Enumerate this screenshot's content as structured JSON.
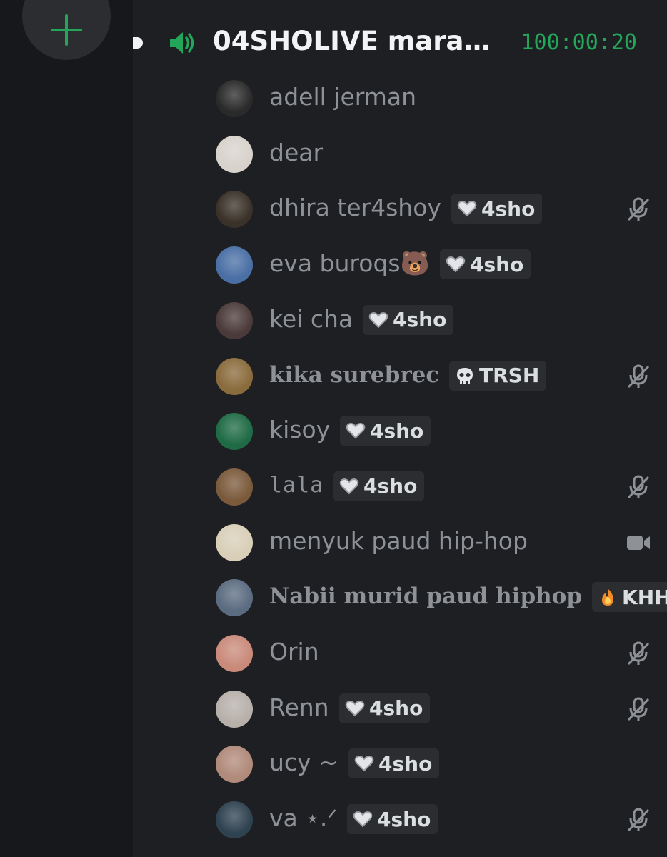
{
  "channel": {
    "name": "04SHOLIVE marat...",
    "timer": "100:00:20"
  },
  "members": [
    {
      "name": "adell jerman",
      "tag": null,
      "tag_icon": null,
      "status": null,
      "style": "normal",
      "avatar": "#2a2a2a"
    },
    {
      "name": "dear",
      "tag": null,
      "tag_icon": null,
      "status": null,
      "style": "normal",
      "avatar": "#d8d2cc"
    },
    {
      "name": "dhira ter4shoy",
      "tag": "4sho",
      "tag_icon": "heart-icon",
      "status": "muted",
      "style": "normal",
      "avatar": "#3a3128"
    },
    {
      "name": "eva buroqs🐻",
      "tag": "4sho",
      "tag_icon": "heart-icon",
      "status": null,
      "style": "normal",
      "avatar": "#4a6fa5"
    },
    {
      "name": "kei cha",
      "tag": "4sho",
      "tag_icon": "heart-icon",
      "status": null,
      "style": "normal",
      "avatar": "#4b3a3a"
    },
    {
      "name": "kika surebrec",
      "tag": "TRSH",
      "tag_icon": "skull-icon",
      "status": "muted",
      "style": "serif",
      "avatar": "#8a6b3c"
    },
    {
      "name": "kisoy",
      "tag": "4sho",
      "tag_icon": "heart-icon",
      "status": null,
      "style": "normal",
      "avatar": "#1f6b45"
    },
    {
      "name": "lala",
      "tag": "4sho",
      "tag_icon": "heart-icon",
      "status": "muted",
      "style": "pixel",
      "avatar": "#7a5a3b"
    },
    {
      "name": "menyuk paud hip-hop",
      "tag": null,
      "tag_icon": null,
      "status": "video",
      "style": "normal",
      "avatar": "#d9cfb8"
    },
    {
      "name": "Nabii murid paud hiphop",
      "tag": "KHH",
      "tag_icon": "fire-icon",
      "status": null,
      "style": "serif",
      "avatar": "#5b6b80"
    },
    {
      "name": "Orin",
      "tag": null,
      "tag_icon": null,
      "status": "muted",
      "style": "normal",
      "avatar": "#c98a7a"
    },
    {
      "name": "Renn",
      "tag": "4sho",
      "tag_icon": "heart-icon",
      "status": "muted",
      "style": "normal",
      "avatar": "#b7b0aa"
    },
    {
      "name": "ucy ~",
      "tag": "4sho",
      "tag_icon": "heart-icon",
      "status": null,
      "style": "normal",
      "avatar": "#b08a7a"
    },
    {
      "name": "va ⋆.ᐟ",
      "tag": "4sho",
      "tag_icon": "heart-icon",
      "status": "muted",
      "style": "normal",
      "avatar": "#2f4250"
    }
  ],
  "colors": {
    "background": "#1e1f22",
    "rail": "#17181b",
    "accent_green": "#23a55a",
    "username": "#8e9297",
    "tag_bg": "#2b2d31"
  }
}
